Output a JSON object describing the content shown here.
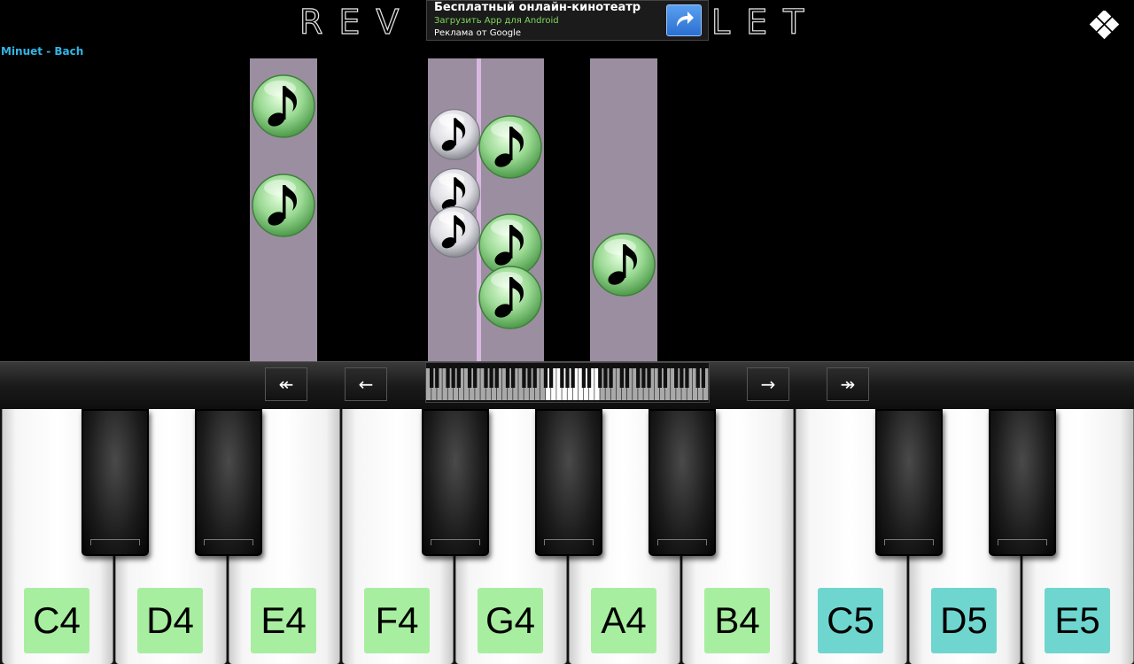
{
  "header": {
    "logo_left": "REV",
    "logo_right": "LET",
    "menu_icon": "diamond-menu-icon"
  },
  "ad": {
    "title": "Бесплатный онлайн-кинотеатр",
    "subtitle": "Загрузить App для Android",
    "source": "Реклама от Google",
    "button_icon": "share-arrow-icon"
  },
  "song": {
    "title": "Minuet - Bach"
  },
  "controls": {
    "fast_back": "↞",
    "back": "←",
    "forward": "→",
    "fast_forward": "↠"
  },
  "keys": {
    "white": [
      {
        "label": "C4",
        "color": "#a8eea0"
      },
      {
        "label": "D4",
        "color": "#a8eea0"
      },
      {
        "label": "E4",
        "color": "#a8eea0"
      },
      {
        "label": "F4",
        "color": "#a8eea0"
      },
      {
        "label": "G4",
        "color": "#a8eea0"
      },
      {
        "label": "A4",
        "color": "#a8eea0"
      },
      {
        "label": "B4",
        "color": "#a8eea0"
      },
      {
        "label": "C5",
        "color": "#6fd6cf"
      },
      {
        "label": "D5",
        "color": "#6fd6cf"
      },
      {
        "label": "E5",
        "color": "#6fd6cf"
      }
    ]
  },
  "colors": {
    "lane": "#9b8ea0",
    "note_green": "#8fd98a",
    "note_white": "#e8e8ec",
    "accent_blue": "#33b5e5"
  }
}
